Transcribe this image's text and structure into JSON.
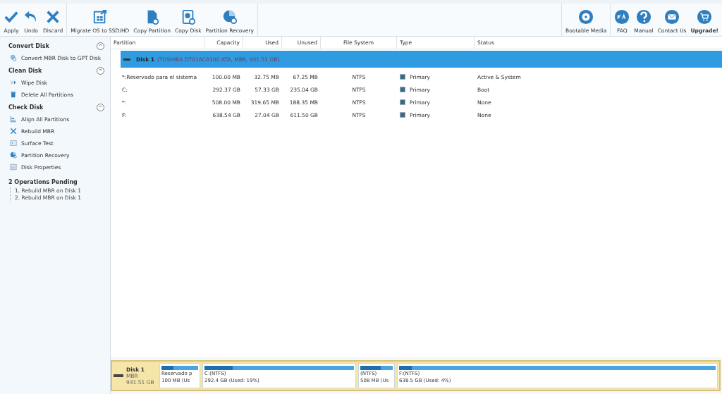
{
  "toolbar": {
    "groups": [
      {
        "buttons": [
          {
            "label": "Apply"
          },
          {
            "label": "Undo"
          },
          {
            "label": "Discard"
          }
        ]
      },
      {
        "buttons": [
          {
            "label": "Migrate OS to SSD/HD"
          },
          {
            "label": "Copy Partition"
          },
          {
            "label": "Copy Disk"
          },
          {
            "label": "Partition Recovery"
          }
        ]
      }
    ],
    "right_groups": [
      {
        "buttons": [
          {
            "label": "Bootable Media",
            "bold": false
          }
        ]
      },
      {
        "buttons": [
          {
            "label": "FAQ",
            "bold": false
          },
          {
            "label": "Manual",
            "bold": false
          },
          {
            "label": "Contact Us",
            "bold": false
          },
          {
            "label": "Upgrade!",
            "bold": true
          }
        ]
      }
    ]
  },
  "sidebar": {
    "sections": [
      {
        "title": "Convert Disk",
        "collapse": "^",
        "items": [
          {
            "label": "Convert MBR Disk to GPT Disk"
          }
        ]
      },
      {
        "title": "Clean Disk",
        "collapse": "^",
        "items": [
          {
            "label": "Wipe Disk"
          },
          {
            "label": "Delete All Partitions"
          }
        ]
      },
      {
        "title": "Check Disk",
        "collapse": "^",
        "items": [
          {
            "label": "Align All Partitions"
          },
          {
            "label": "Rebuild MBR"
          },
          {
            "label": "Surface Test"
          },
          {
            "label": "Partition Recovery"
          },
          {
            "label": "Disk Properties"
          }
        ]
      }
    ],
    "pending": {
      "title": "2 Operations Pending",
      "items": [
        "1. Rebuild MBR on Disk 1",
        "2. Rebuild MBR on Disk 1"
      ]
    }
  },
  "table": {
    "columns": [
      "Partition",
      "Capacity",
      "Used",
      "Unused",
      "File System",
      "Type",
      "Status"
    ],
    "disk": {
      "name": "Disk 1",
      "info": "(TOSHIBA DT01ACA100 ATA, MBR, 931.51 GB)",
      "selected": true
    },
    "rows": [
      {
        "partition": "*:Reservado para el sistema",
        "capacity": "100.00 MB",
        "used": "32.75 MB",
        "unused": "67.25 MB",
        "fs": "NTFS",
        "type": "Primary",
        "status": "Active & System"
      },
      {
        "partition": "C:",
        "capacity": "292.37 GB",
        "used": "57.33 GB",
        "unused": "235.04 GB",
        "fs": "NTFS",
        "type": "Primary",
        "status": "Boot"
      },
      {
        "partition": "*:",
        "capacity": "508.00 MB",
        "used": "319.65 MB",
        "unused": "188.35 MB",
        "fs": "NTFS",
        "type": "Primary",
        "status": "None"
      },
      {
        "partition": "F:",
        "capacity": "638.54 GB",
        "used": "27.04 GB",
        "unused": "611.50 GB",
        "fs": "NTFS",
        "type": "Primary",
        "status": "None"
      }
    ]
  },
  "disk_map": {
    "disk": {
      "name": "Disk 1",
      "scheme": "MBR",
      "size": "931.51 GB",
      "selected": true
    },
    "partitions": [
      {
        "label": "Reservado p",
        "detail": "100 MB (Us",
        "level": 0.33
      },
      {
        "label": "C:(NTFS)",
        "detail": "292.4 GB (Used: 19%)",
        "level": 0.19
      },
      {
        "label": "(NTFS)",
        "detail": "508 MB (Us",
        "level": 0.63
      },
      {
        "label": "F:(NTFS)",
        "detail": "638.5 GB (Used: 4%)",
        "level": 0.04
      }
    ]
  }
}
